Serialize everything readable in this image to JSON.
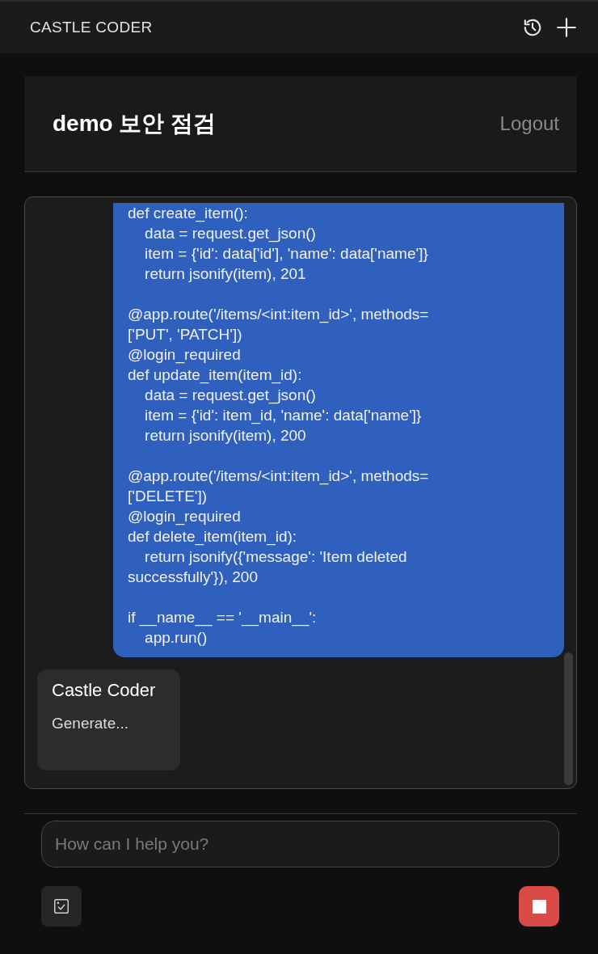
{
  "app_bar": {
    "title": "CASTLE CODER"
  },
  "session": {
    "title": "demo 보안 점검",
    "logout": "Logout"
  },
  "messages": [
    {
      "kind": "user",
      "blocks": [
        [
          "def create_item():",
          "    data = request.get_json()",
          "    item = {'id': data['id'], 'name': data['name']}",
          "    return jsonify(item), 201"
        ],
        [
          "@app.route('/items/<int:item_id>', methods=",
          "['PUT', 'PATCH'])",
          "@login_required",
          "def update_item(item_id):",
          "    data = request.get_json()",
          "    item = {'id': item_id, 'name': data['name']}",
          "    return jsonify(item), 200"
        ],
        [
          "@app.route('/items/<int:item_id>', methods=",
          "['DELETE'])",
          "@login_required",
          "def delete_item(item_id):",
          "    return jsonify({'message': 'Item deleted",
          "successfully'}), 200"
        ],
        [
          "if __name__ == '__main__':",
          "    app.run()"
        ]
      ]
    },
    {
      "kind": "assistant",
      "sender": "Castle Coder",
      "text": "Generate..."
    }
  ],
  "composer": {
    "placeholder": "How can I help you?"
  }
}
